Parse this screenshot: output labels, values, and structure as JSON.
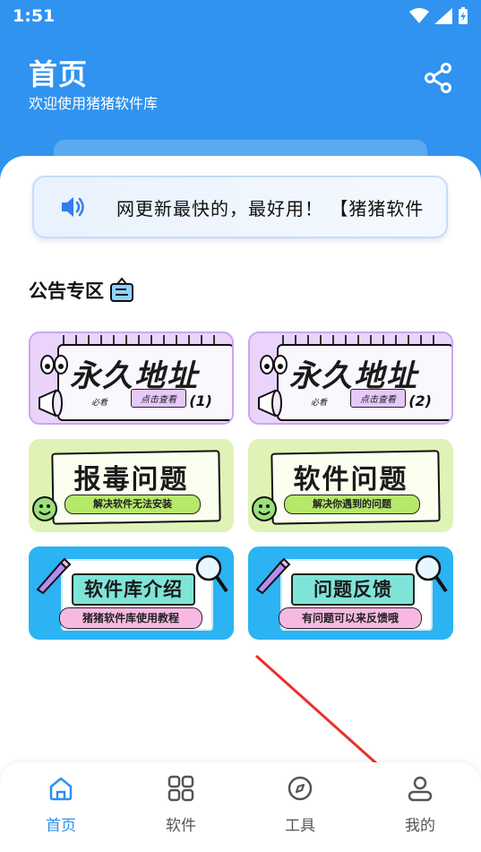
{
  "status_bar": {
    "time": "1:51"
  },
  "header": {
    "title": "首页",
    "subtitle": "欢迎使用猪猪软件库",
    "share_icon": "share-icon"
  },
  "notice": {
    "text": "网更新最快的，最好用！ 【猪猪软件",
    "icon": "speaker-icon"
  },
  "announcements": {
    "section_title": "公告专区",
    "cards": [
      {
        "title": "永久地址",
        "tag": "必看",
        "button": "点击查看",
        "number": "(1)"
      },
      {
        "title": "永久地址",
        "tag": "必看",
        "button": "点击查看",
        "number": "(2)"
      },
      {
        "title": "报毒问题",
        "subtitle": "解决软件无法安装"
      },
      {
        "title": "软件问题",
        "subtitle": "解决你遇到的问题"
      },
      {
        "title": "软件库介绍",
        "subtitle": "猪猪软件库使用教程"
      },
      {
        "title": "问题反馈",
        "subtitle": "有问题可以来反馈哦"
      }
    ]
  },
  "tabbar": {
    "tabs": [
      {
        "label": "首页",
        "icon": "home-icon",
        "active": true
      },
      {
        "label": "软件",
        "icon": "grid-icon",
        "active": false
      },
      {
        "label": "工具",
        "icon": "compass-icon",
        "active": false
      },
      {
        "label": "我的",
        "icon": "user-icon",
        "active": false
      }
    ]
  },
  "colors": {
    "primary": "#2f93ef",
    "tab_active": "#2f8ff0",
    "annotation": "#e8312a"
  }
}
